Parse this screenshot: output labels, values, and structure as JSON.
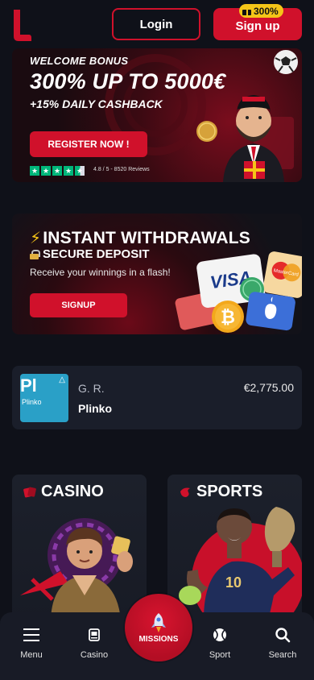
{
  "header": {
    "login_label": "Login",
    "signup_label": "Sign up",
    "signup_badge": "300%"
  },
  "banner_bonus": {
    "kicker": "WELCOME BONUS",
    "title": "300% UP TO 5000€",
    "subtitle": "+15% DAILY CASHBACK",
    "cta_label": "REGISTER NOW !",
    "rating_text": "4.8 / 5 - 8520 Reviews",
    "rating_stars": 4.5
  },
  "banner_withdrawals": {
    "title": "INSTANT WITHDRAWALS",
    "subtitle": "SECURE DEPOSIT",
    "description": "Receive your winnings in a flash!",
    "cta_label": "SIGNUP",
    "payment_logos": [
      "VISA",
      "MasterCard"
    ]
  },
  "recent_win": {
    "thumb_abbr": "Pl",
    "thumb_name": "Plinko",
    "user": "G. R.",
    "game": "Plinko",
    "amount": "€2,775.00"
  },
  "categories": [
    {
      "title": "CASINO",
      "icon": "cards-icon"
    },
    {
      "title": "SPORTS",
      "icon": "flame-icon"
    }
  ],
  "bottom_nav": {
    "menu_label": "Menu",
    "casino_label": "Casino",
    "missions_label": "MISSIONS",
    "sport_label": "Sport",
    "search_label": "Search"
  },
  "colors": {
    "background": "#0f1119",
    "accent": "#d0112b",
    "badge": "#f5c518",
    "card": "#1a1e2a",
    "plinko": "#2aa0c7"
  }
}
